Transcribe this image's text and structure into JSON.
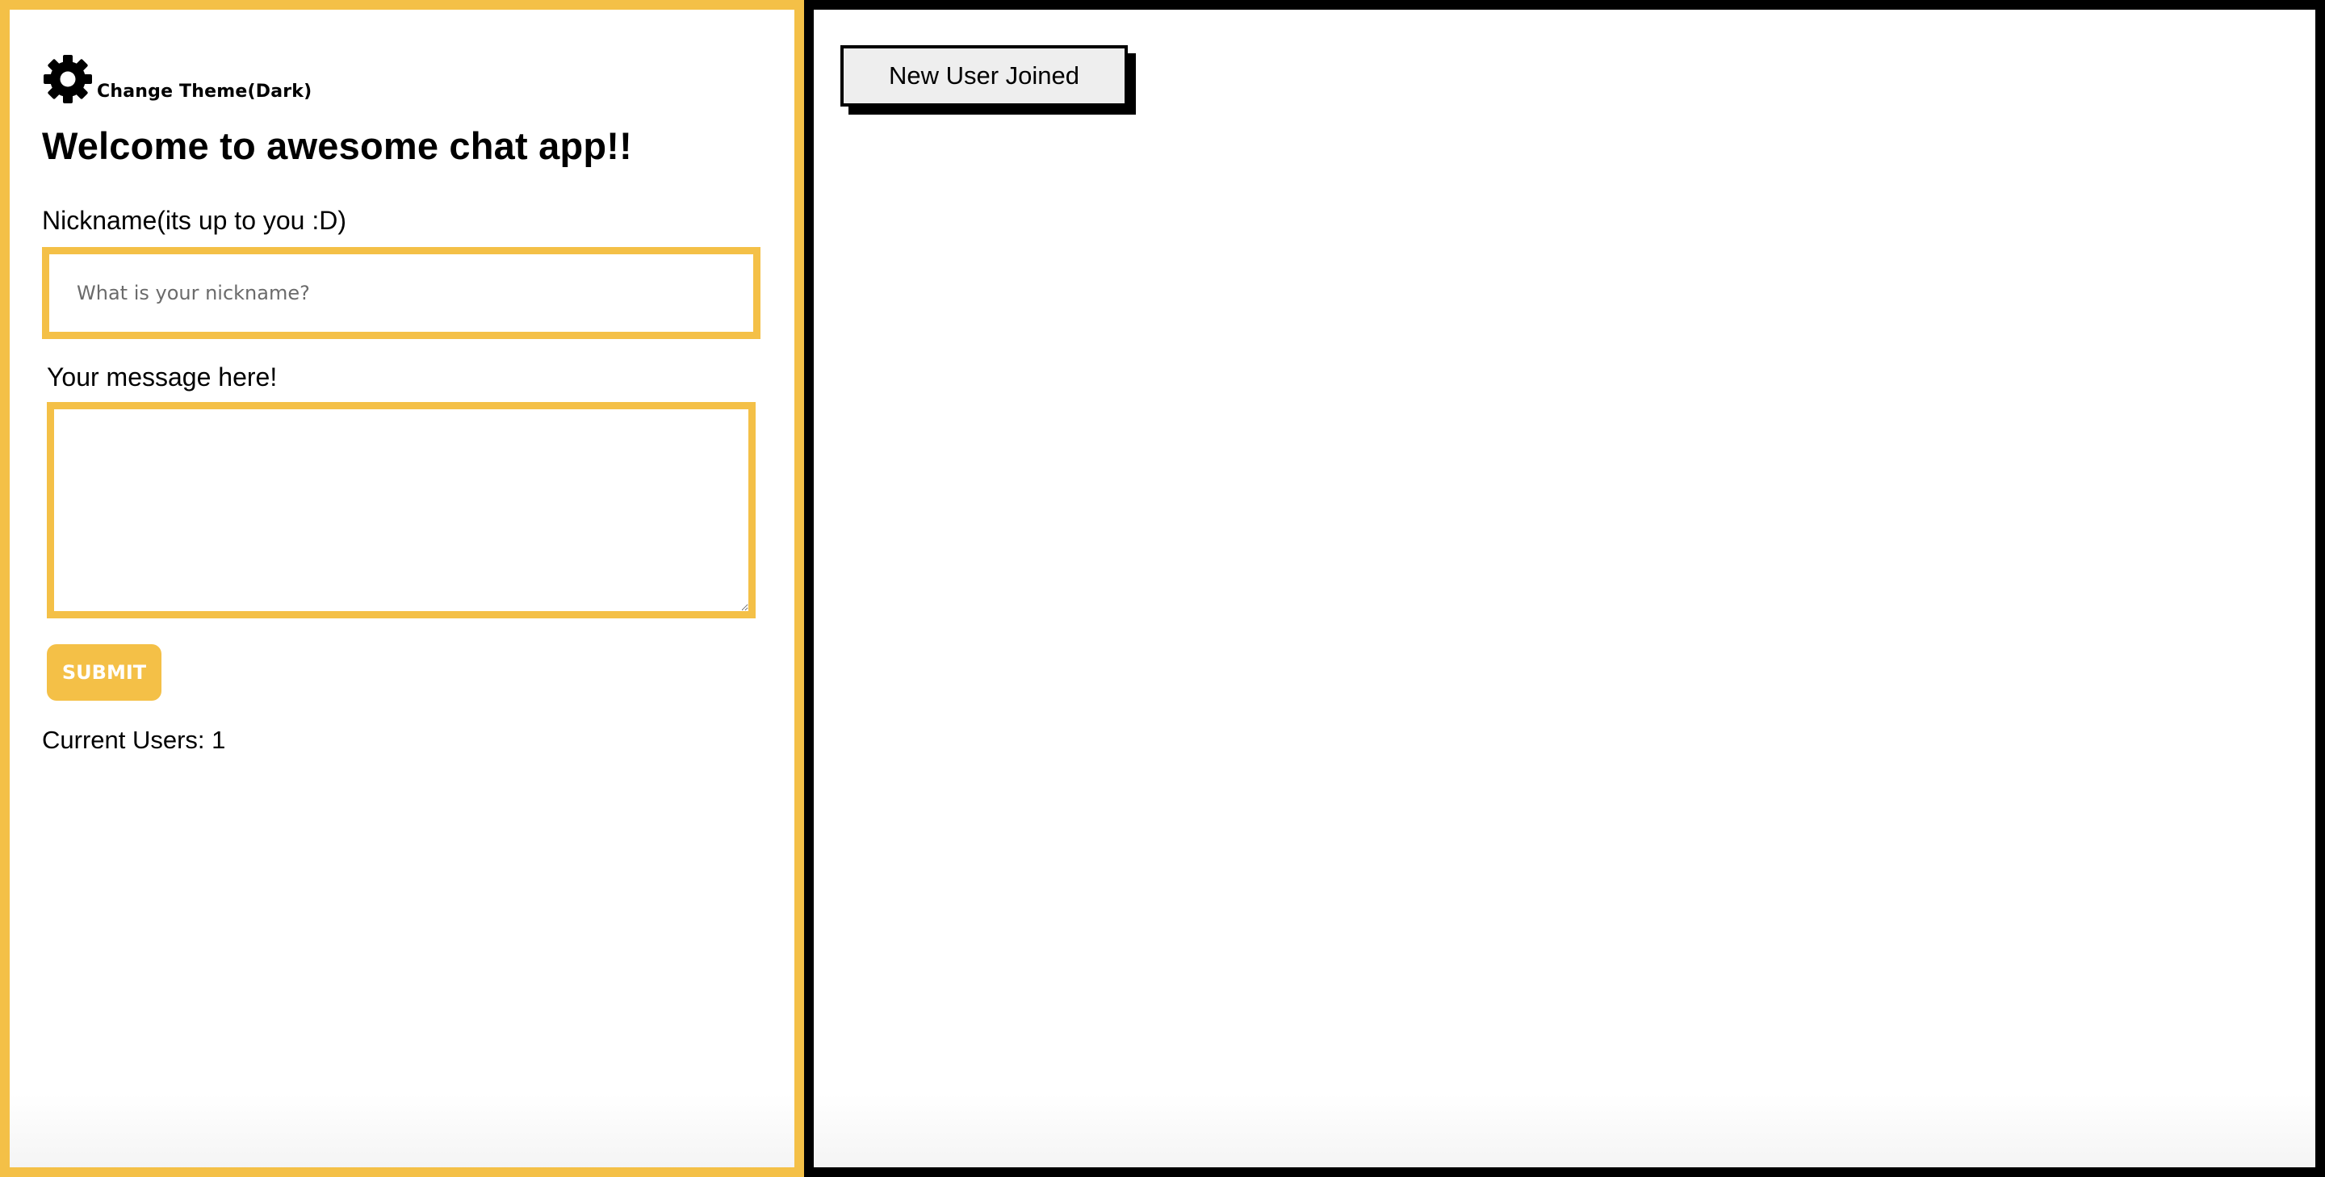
{
  "sidebar": {
    "theme_icon": "gear-icon",
    "theme_label": "Change Theme(Dark)",
    "welcome_title": "Welcome to awesome chat app!!",
    "nickname_label": "Nickname(its up to you :D)",
    "nickname_placeholder": "What is your nickname?",
    "nickname_value": "",
    "message_label": "Your message here!",
    "message_value": "",
    "submit_label": "SUBMIT",
    "current_users": "Current Users: 1"
  },
  "chat": {
    "messages": [
      {
        "text": "New User Joined"
      }
    ]
  },
  "colors": {
    "accent": "#f4c047",
    "chat_border": "#000000",
    "notice_bg": "#eeeeee"
  }
}
